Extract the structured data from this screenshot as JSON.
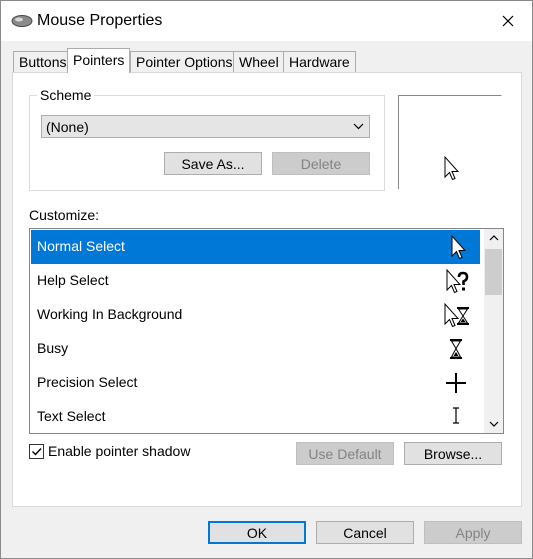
{
  "window": {
    "title": "Mouse Properties",
    "close_symbol": "✕"
  },
  "tabs": [
    {
      "label": "Buttons"
    },
    {
      "label": "Pointers",
      "active": true
    },
    {
      "label": "Pointer Options"
    },
    {
      "label": "Wheel"
    },
    {
      "label": "Hardware"
    }
  ],
  "scheme": {
    "group_label": "Scheme",
    "selected": "(None)",
    "save_as_label": "Save As...",
    "delete_label": "Delete"
  },
  "customize": {
    "label": "Customize:",
    "items": [
      {
        "label": "Normal Select",
        "icon": "arrow-cursor-icon",
        "selected": true
      },
      {
        "label": "Help Select",
        "icon": "help-cursor-icon"
      },
      {
        "label": "Working In Background",
        "icon": "working-cursor-icon"
      },
      {
        "label": "Busy",
        "icon": "hourglass-cursor-icon"
      },
      {
        "label": "Precision Select",
        "icon": "crosshair-cursor-icon"
      },
      {
        "label": "Text Select",
        "icon": "ibeam-cursor-icon"
      }
    ]
  },
  "shadow": {
    "label": "Enable pointer shadow",
    "checked": true
  },
  "buttons": {
    "use_default": "Use Default",
    "browse": "Browse...",
    "ok": "OK",
    "cancel": "Cancel",
    "apply": "Apply"
  },
  "colors": {
    "accent": "#0078d7",
    "disabled_text": "#838383"
  }
}
